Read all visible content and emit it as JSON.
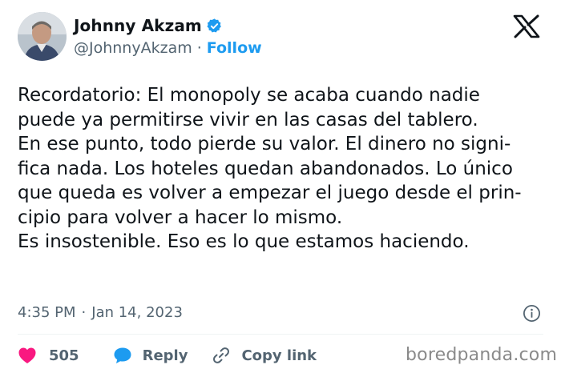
{
  "author": {
    "display_name": "Johnny Akzam",
    "handle": "@JohnnyAkzam",
    "separator": "·",
    "follow_label": "Follow",
    "verified": true
  },
  "tweet": {
    "lines": [
      "Recordatorio: El monopoly se acaba cuando nadie",
      "puede ya permitirse vivir en las casas del tablero.",
      "En ese punto, todo pierde su valor. El dinero no signi-",
      "fica nada. Los hoteles quedan abandonados. Lo único",
      "que queda es volver a empezar el juego desde el prin-",
      "cipio para volver a hacer lo mismo.",
      "Es insostenible. Eso es lo que estamos haciendo."
    ],
    "time": "4:35 PM",
    "separator": "·",
    "date": "Jan 14, 2023"
  },
  "actions": {
    "like_count": "505",
    "reply_label": "Reply",
    "copy_link_label": "Copy link"
  },
  "watermark": "boredpanda.com",
  "icons": {
    "verified": "verified-badge-icon",
    "x_logo": "x-logo-icon",
    "info": "info-icon",
    "like": "heart-icon",
    "reply": "speech-bubble-icon",
    "copy": "link-icon"
  },
  "colors": {
    "accent": "#1d9bf0",
    "like": "#f91880",
    "text": "#0f1419",
    "muted": "#536471"
  }
}
